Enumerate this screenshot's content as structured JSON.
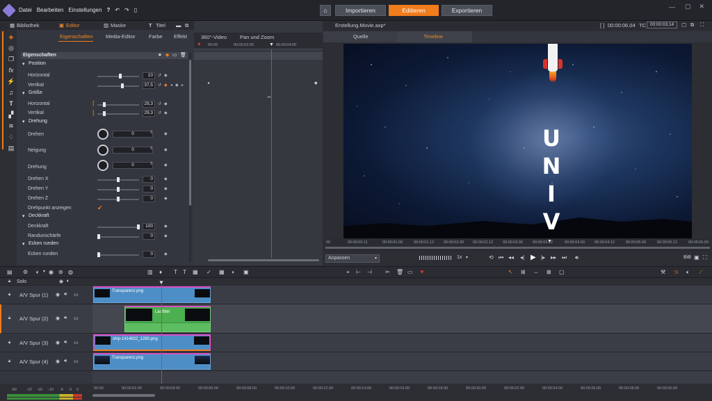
{
  "menu": {
    "items": [
      "Datei",
      "Bearbeiten",
      "Einstellungen"
    ],
    "help": "?"
  },
  "nav": {
    "importieren": "Importieren",
    "editieren": "Editieren",
    "exportieren": "Exportieren"
  },
  "library_tabs": {
    "bibliothek": "Bibliothek",
    "editor": "Editor",
    "maske": "Maske",
    "titel": "Titel"
  },
  "editor_tabs": [
    "Eigenschaften",
    "Media-Editor",
    "Farbe",
    "Effekt",
    "360°-Video",
    "Pan und Zoom"
  ],
  "properties": {
    "header": "Eigenschaften",
    "position": "Position",
    "horizontal": "Horizontal",
    "horizontal_val": "10",
    "vertikal": "Vertikal",
    "vertikal_val": "37,5",
    "groesse": "Größe",
    "g_horizontal": "Horizontal",
    "g_horizontal_val": "29,3",
    "g_vertikal": "Vertikal",
    "g_vertikal_val": "29,3",
    "drehung": "Drehung",
    "drehen": "Drehen",
    "drehen_val": "0",
    "neigung": "Neigung",
    "neigung_val": "0",
    "drehung2": "Drehung",
    "drehung2_val": "0",
    "drehen_x": "Drehen X",
    "drehen_x_val": "0",
    "drehen_y": "Drehen Y",
    "drehen_y_val": "0",
    "drehen_z": "Drehen Z",
    "drehen_z_val": "0",
    "drehpunkt": "Drehpunkt anzeigen",
    "deckkraft_head": "Deckkraft",
    "deckkraft": "Deckkraft",
    "deckkraft_val": "100",
    "randunschaerfe": "Randunschärfe",
    "randunschaerfe_val": "0",
    "ecken_head": "Ecken runden",
    "ecken": "Ecken runden",
    "ecken_val": "0"
  },
  "kf_ruler": [
    "00:00",
    "00:00:02:00",
    "00:00:04:00"
  ],
  "preview": {
    "file": "Erstellung.Movie.axp*",
    "tc_left": "00:00:06.04",
    "tc_label": "TC",
    "tc_right": "00:00:03.14",
    "tab_quelle": "Quelle",
    "tab_timeline": "Timeline",
    "text": "UNIV",
    "ruler": [
      "00",
      "00:00:00.11",
      "00:00:01.00",
      "00:00:01.12",
      "00:00:02.00",
      "00:00:02.12",
      "00:00:03.00",
      "00:00:03.12",
      "00:00:04.00",
      "00:00:04.12",
      "00:00:05.00",
      "00:00:05.12",
      "00:00:06.00"
    ],
    "anpassen": "Anpassen",
    "speed": "1x",
    "bib": "BiB"
  },
  "timeline": {
    "solo": "Solo",
    "tracks": [
      "A/V Spur (1)",
      "A/V Spur (2)",
      "A/V Spur (3)",
      "A/V Spur (4)"
    ],
    "clips": [
      "Transparenz.png",
      "Lauftitel",
      "ship-1414822_1280.png",
      "Transparenz.png"
    ],
    "ruler": [
      "00:00",
      "00:00:02.00",
      "00:00:04.00",
      "00:00:06.00",
      "00:00:08.00",
      "00:00:10.00",
      "00:00:12.00",
      "00:00:14.00",
      "00:00:16.00",
      "00:00:18.00",
      "00:00:20.00",
      "00:00:22.00",
      "00:00:24.00",
      "00:00:26.00",
      "00:00:28.00",
      "00:00:30.00"
    ],
    "vu_labels": [
      "-50",
      "-22",
      "-16",
      "-10",
      "-6",
      "-3",
      "0"
    ]
  },
  "colors": {
    "accent": "#f07c1c",
    "clip_blue": "#4d8ec7",
    "clip_green": "#4caf50",
    "playhead": "#e03a2a"
  }
}
